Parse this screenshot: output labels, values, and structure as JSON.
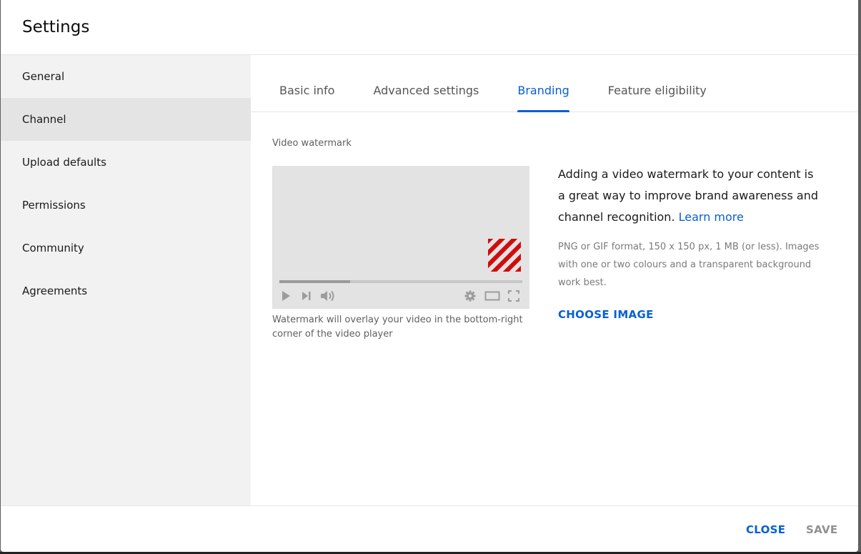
{
  "dialog": {
    "title": "Settings"
  },
  "sidebar": {
    "items": [
      {
        "label": "General",
        "active": false
      },
      {
        "label": "Channel",
        "active": true
      },
      {
        "label": "Upload defaults",
        "active": false
      },
      {
        "label": "Permissions",
        "active": false
      },
      {
        "label": "Community",
        "active": false
      },
      {
        "label": "Agreements",
        "active": false
      }
    ]
  },
  "tabs": [
    {
      "label": "Basic info",
      "active": false
    },
    {
      "label": "Advanced settings",
      "active": false
    },
    {
      "label": "Branding",
      "active": true
    },
    {
      "label": "Feature eligibility",
      "active": false
    }
  ],
  "branding": {
    "section_label": "Video watermark",
    "preview": {
      "progress_fraction": 0.29,
      "icons": [
        "play-icon",
        "next-icon",
        "volume-icon",
        "gear-icon",
        "theater-mode-icon",
        "fullscreen-icon"
      ]
    },
    "caption": "Watermark will overlay your video in the bottom-right corner of the video player",
    "description": "Adding a video watermark to your content is a great way to improve brand awareness and channel recognition.",
    "learn_more": "Learn more",
    "hint": "PNG or GIF format, 150 x 150 px, 1 MB (or less). Images with one or two colours and a transparent background work best.",
    "choose_image": "CHOOSE IMAGE"
  },
  "footer": {
    "close_label": "CLOSE",
    "save_label": "SAVE"
  },
  "colors": {
    "accent": "#065fd4",
    "watermark": "#d20c0c",
    "sidebar_bg": "#f2f2f2",
    "sidebar_active": "#e4e4e4"
  }
}
